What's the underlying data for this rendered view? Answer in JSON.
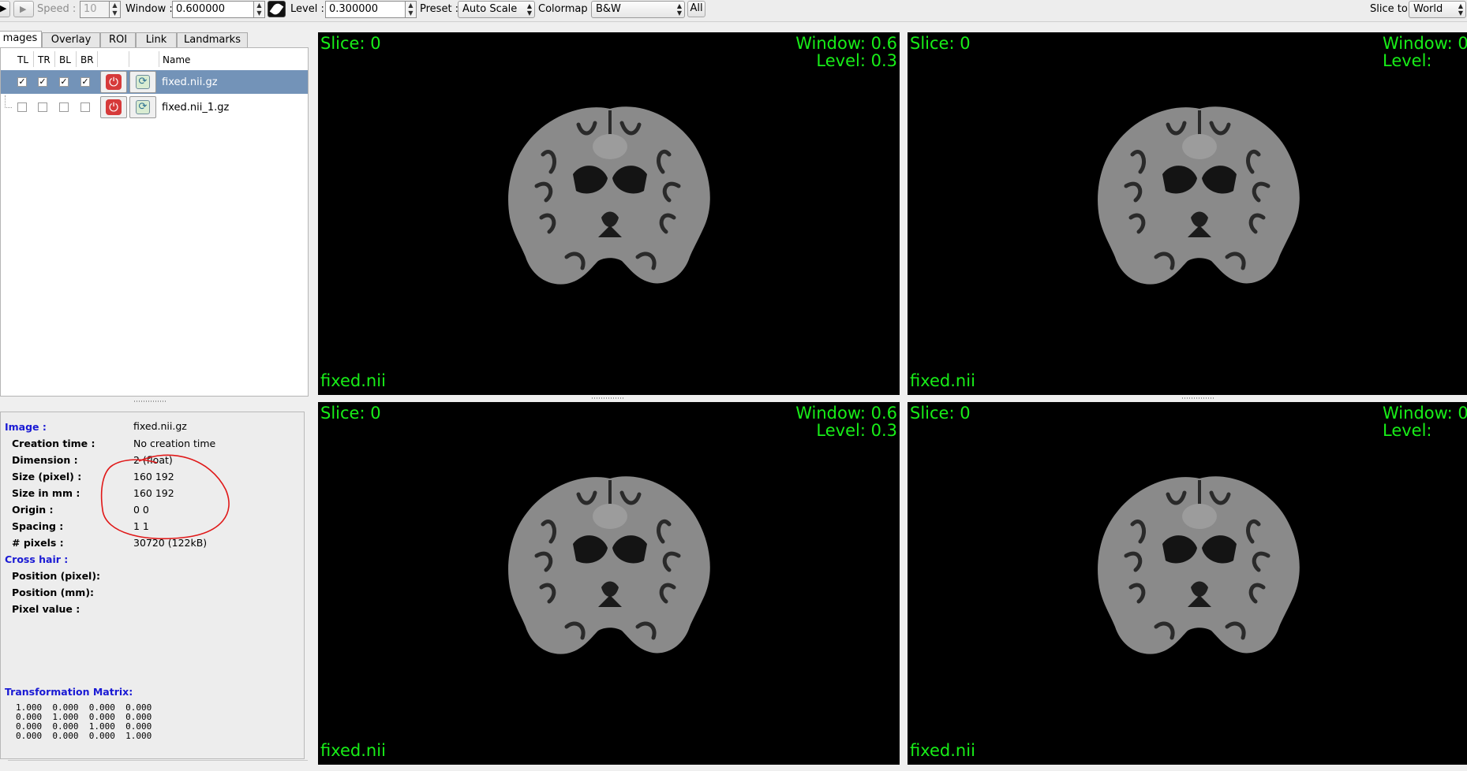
{
  "toolbar": {
    "speed_label": "Speed :",
    "speed_value": "10",
    "window_label": "Window :",
    "window_value": "0.600000",
    "level_label": "Level :",
    "level_value": "0.300000",
    "preset_label": "Preset :",
    "preset_value": "Auto Scale",
    "colormap_label": "Colormap :",
    "colormap_value": "B&W",
    "all_button": "All",
    "slice_to_label": "Slice to",
    "slice_to_value": "World"
  },
  "tabs": [
    {
      "label": "Images",
      "shown": "mages",
      "active": true
    },
    {
      "label": "Overlay"
    },
    {
      "label": "ROI"
    },
    {
      "label": "Link"
    },
    {
      "label": "Landmarks"
    }
  ],
  "image_list": {
    "columns": [
      "TL",
      "TR",
      "BL",
      "BR",
      "Name"
    ],
    "rows": [
      {
        "name": "fixed.nii.gz",
        "selected": true,
        "checks": [
          true,
          true,
          true,
          true
        ]
      },
      {
        "name": "fixed.nii_1.gz",
        "selected": false,
        "checks": [
          false,
          false,
          false,
          false
        ]
      }
    ]
  },
  "info": {
    "image_heading": "Image :",
    "image_value": "fixed.nii.gz",
    "fields": [
      {
        "key": "Creation time :",
        "value": "No creation time"
      },
      {
        "key": "Dimension :",
        "value": "2 (float)"
      },
      {
        "key": "Size (pixel) :",
        "value": "160 192"
      },
      {
        "key": "Size in mm :",
        "value": "160 192"
      },
      {
        "key": "Origin :",
        "value": "0 0"
      },
      {
        "key": "Spacing :",
        "value": "1 1"
      },
      {
        "key": "# pixels :",
        "value": "30720 (122kB)"
      }
    ],
    "crosshair_heading": "Cross hair :",
    "crosshair_fields": [
      {
        "key": "Position (pixel):",
        "value": ""
      },
      {
        "key": "Position (mm):",
        "value": ""
      },
      {
        "key": "Pixel value :",
        "value": ""
      }
    ],
    "matrix_heading": "Transformation Matrix:",
    "matrix": [
      [
        "1.000",
        "0.000",
        "0.000",
        "0.000"
      ],
      [
        "0.000",
        "1.000",
        "0.000",
        "0.000"
      ],
      [
        "0.000",
        "0.000",
        "1.000",
        "0.000"
      ],
      [
        "0.000",
        "0.000",
        "0.000",
        "1.000"
      ]
    ],
    "annotation_color": "#e01818"
  },
  "viewers": {
    "overlay_color": "#18ee18",
    "panels": [
      {
        "slice": "Slice: 0",
        "window": "Window: 0.6",
        "level": "Level: 0.3",
        "name": "fixed.nii"
      },
      {
        "slice": "Slice: 0",
        "window": "Window: 0",
        "level": "Level: ",
        "name": "fixed.nii"
      },
      {
        "slice": "Slice: 0",
        "window": "Window: 0.6",
        "level": "Level: 0.3",
        "name": "fixed.nii"
      },
      {
        "slice": "Slice: 0",
        "window": "Window: 0",
        "level": "Level: ",
        "name": "fixed.nii"
      }
    ]
  }
}
